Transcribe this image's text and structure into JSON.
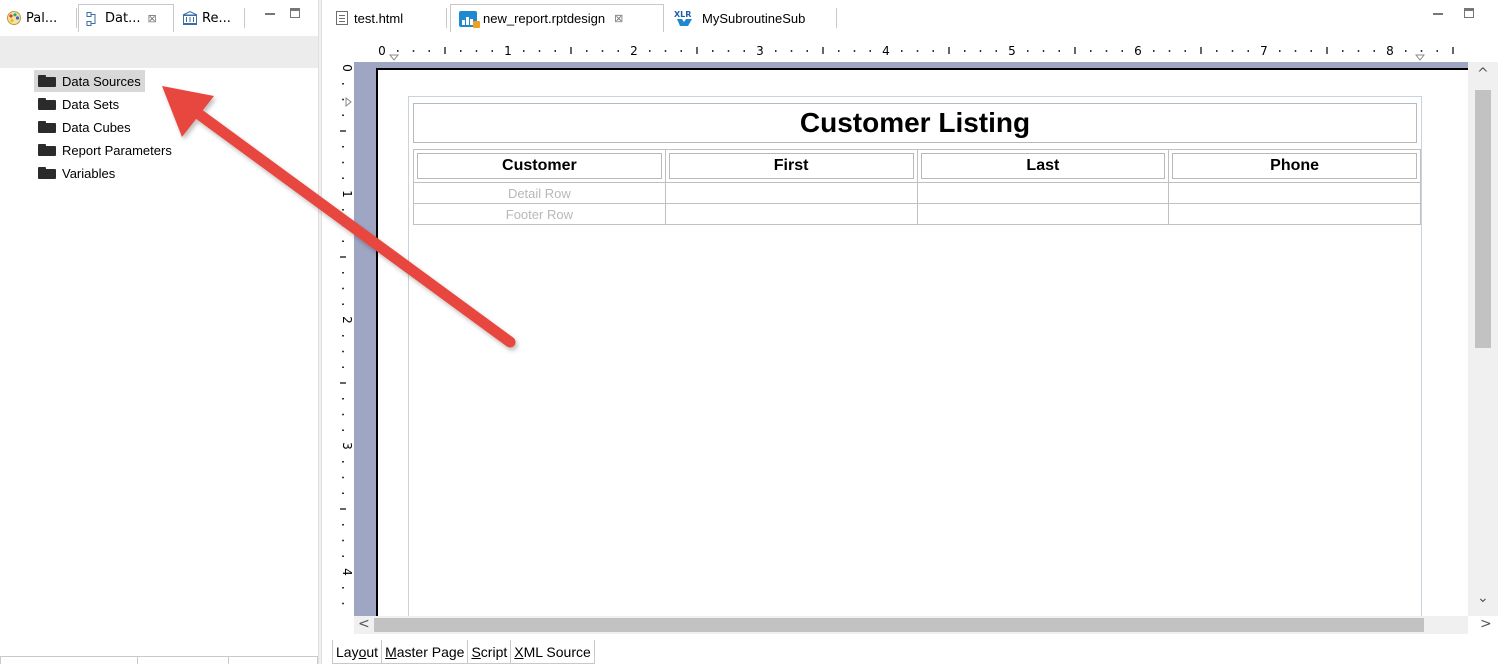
{
  "left_view": {
    "tabs": [
      {
        "label": "Pal...",
        "icon": "palette-icon"
      },
      {
        "label": "Dat...",
        "icon": "data-explorer-icon",
        "close": "⊠"
      },
      {
        "label": "Re...",
        "icon": "resource-explorer-icon"
      }
    ],
    "tree": [
      {
        "label": "Data Sources",
        "selected": true
      },
      {
        "label": "Data Sets"
      },
      {
        "label": "Data Cubes"
      },
      {
        "label": "Report Parameters"
      },
      {
        "label": "Variables"
      }
    ]
  },
  "editor": {
    "tabs": [
      {
        "label": "test.html",
        "icon": "html-file-icon"
      },
      {
        "label": "new_report.rptdesign",
        "icon": "report-design-icon",
        "close": "⊠",
        "active": true
      },
      {
        "label": "MySubroutineSub",
        "icon": "xlr-icon"
      }
    ],
    "ruler_h_labels": [
      "0",
      "1",
      "2",
      "3",
      "4",
      "5",
      "6",
      "7",
      "8"
    ],
    "ruler_v_labels": [
      "0",
      "1",
      "2",
      "3",
      "4"
    ],
    "report": {
      "title": "Customer Listing",
      "columns": [
        "Customer",
        "First",
        "Last",
        "Phone"
      ],
      "detail_row": "Detail Row",
      "footer_row": "Footer Row"
    },
    "page_tabs": {
      "layout": {
        "pre": "Lay",
        "mn": "o",
        "post": "ut"
      },
      "master": {
        "pre": "",
        "mn": "M",
        "post": "aster Page"
      },
      "script": {
        "pre": "",
        "mn": "S",
        "post": "cript"
      },
      "xml": {
        "pre": "",
        "mn": "X",
        "post": "ML Source"
      }
    }
  },
  "colors": {
    "canvas_background": "#9ea6c4",
    "annotation_arrow": "#e8473f",
    "selection": "#d8d8d8"
  }
}
